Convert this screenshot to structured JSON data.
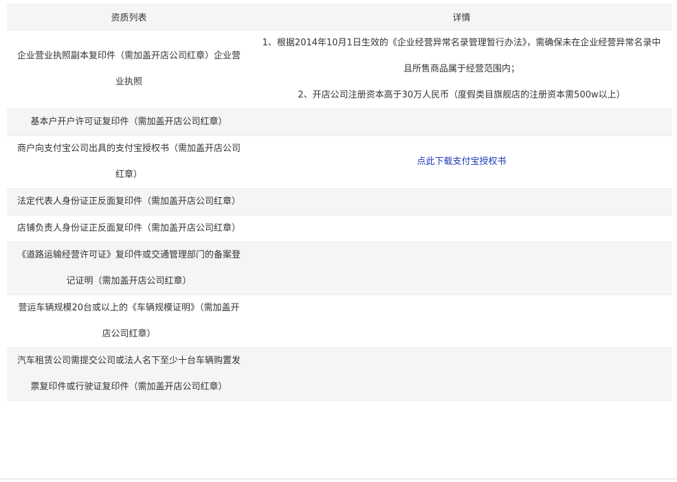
{
  "table": {
    "headers": [
      "资质列表",
      "详情"
    ],
    "rows": [
      {
        "label": "企业营业执照副本复印件（需加盖开店公司红章）企业营业执照",
        "details": [
          "1、根据2014年10月1日生效的《企业经营异常名录管理暂行办法》，需确保未在企业经营异常名录中且所售商品属于经营范围内；",
          "2、开店公司注册资本高于30万人民币（度假类目旗舰店的注册资本需500w以上）"
        ]
      },
      {
        "label": "基本户开户许可证复印件（需加盖开店公司红章）",
        "details": []
      },
      {
        "label": "商户向支付宝公司出具的支付宝授权书（需加盖开店公司红章）",
        "details": [],
        "link": "点此下载支付宝授权书"
      },
      {
        "label": "法定代表人身份证正反面复印件（需加盖开店公司红章）",
        "details": []
      },
      {
        "label": "店铺负责人身份证正反面复印件（需加盖开店公司红章）",
        "details": []
      },
      {
        "label": "《道路运输经营许可证》复印件或交通管理部门的备案登记证明（需加盖开店公司红章）",
        "details": []
      },
      {
        "label": "营运车辆规模20台或以上的《车辆规模证明》（需加盖开店公司红章）",
        "details": []
      },
      {
        "label": "汽车租赁公司需提交公司或法人名下至少十台车辆购置发票复印件或行驶证复印件（需加盖开店公司红章）",
        "details": []
      }
    ]
  },
  "colors": {
    "header_bg": "#f5f5f5",
    "stripe_bg": "#f5f5f5",
    "link": "#1c38b8",
    "text": "#333333"
  }
}
